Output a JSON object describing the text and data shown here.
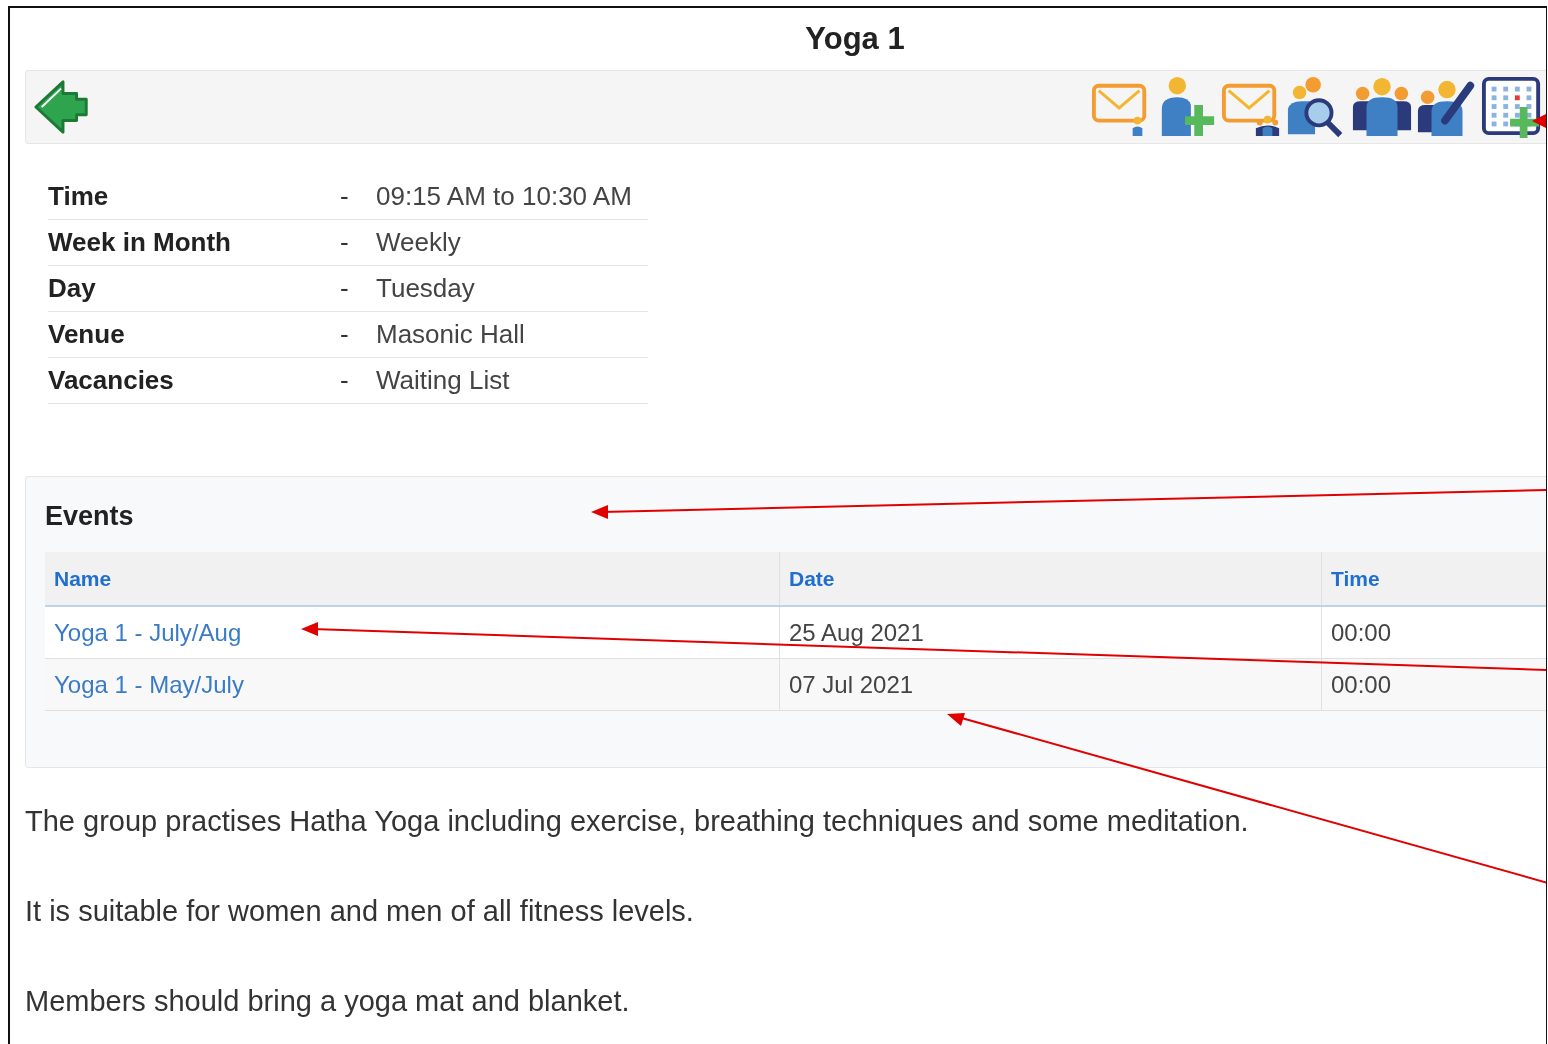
{
  "title": "Yoga 1",
  "details": [
    {
      "label": "Time",
      "value": "09:15 AM to 10:30 AM"
    },
    {
      "label": "Week in Month",
      "value": "Weekly"
    },
    {
      "label": "Day",
      "value": "Tuesday"
    },
    {
      "label": "Venue",
      "value": "Masonic Hall"
    },
    {
      "label": "Vacancies",
      "value": "Waiting List"
    }
  ],
  "separator": "-",
  "events": {
    "heading": "Events",
    "columns": [
      "Name",
      "Date",
      "Time"
    ],
    "rows": [
      {
        "name": "Yoga 1 - July/Aug",
        "date": "25 Aug 2021",
        "time": "00:00"
      },
      {
        "name": "Yoga 1 - May/July",
        "date": "07 Jul 2021",
        "time": "00:00"
      }
    ]
  },
  "paragraphs": [
    "The group practises Hatha Yoga including exercise, breathing techniques and some meditation.",
    "It is suitable for women and men of all fitness levels.",
    "Members should bring a yoga mat and blanket."
  ]
}
